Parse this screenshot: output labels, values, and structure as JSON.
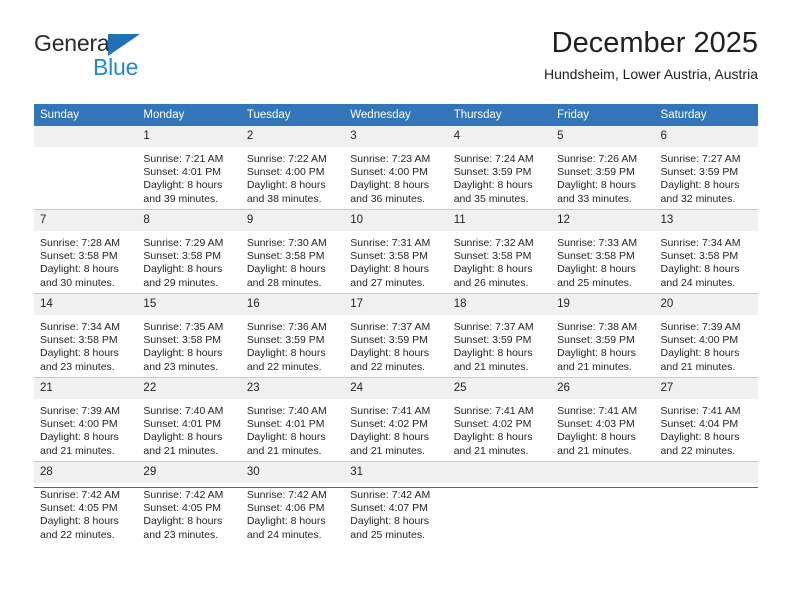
{
  "brand": {
    "name_part1": "General",
    "name_part2": "Blue",
    "logo_icon": "triangle-logo-icon",
    "accent_color": "#1f72b8",
    "text_color": "#2288dd"
  },
  "header": {
    "title": "December 2025",
    "location": "Hundsheim, Lower Austria, Austria"
  },
  "calendar": {
    "header_bg_color": "#3275b8",
    "daynum_bg_color": "#f0f0f0",
    "weekdays": [
      "Sunday",
      "Monday",
      "Tuesday",
      "Wednesday",
      "Thursday",
      "Friday",
      "Saturday"
    ],
    "weeks": [
      [
        {
          "day": "",
          "sunrise": "",
          "sunset": "",
          "daylight_line1": "",
          "daylight_line2": ""
        },
        {
          "day": "1",
          "sunrise": "Sunrise: 7:21 AM",
          "sunset": "Sunset: 4:01 PM",
          "daylight_line1": "Daylight: 8 hours",
          "daylight_line2": "and 39 minutes."
        },
        {
          "day": "2",
          "sunrise": "Sunrise: 7:22 AM",
          "sunset": "Sunset: 4:00 PM",
          "daylight_line1": "Daylight: 8 hours",
          "daylight_line2": "and 38 minutes."
        },
        {
          "day": "3",
          "sunrise": "Sunrise: 7:23 AM",
          "sunset": "Sunset: 4:00 PM",
          "daylight_line1": "Daylight: 8 hours",
          "daylight_line2": "and 36 minutes."
        },
        {
          "day": "4",
          "sunrise": "Sunrise: 7:24 AM",
          "sunset": "Sunset: 3:59 PM",
          "daylight_line1": "Daylight: 8 hours",
          "daylight_line2": "and 35 minutes."
        },
        {
          "day": "5",
          "sunrise": "Sunrise: 7:26 AM",
          "sunset": "Sunset: 3:59 PM",
          "daylight_line1": "Daylight: 8 hours",
          "daylight_line2": "and 33 minutes."
        },
        {
          "day": "6",
          "sunrise": "Sunrise: 7:27 AM",
          "sunset": "Sunset: 3:59 PM",
          "daylight_line1": "Daylight: 8 hours",
          "daylight_line2": "and 32 minutes."
        }
      ],
      [
        {
          "day": "7",
          "sunrise": "Sunrise: 7:28 AM",
          "sunset": "Sunset: 3:58 PM",
          "daylight_line1": "Daylight: 8 hours",
          "daylight_line2": "and 30 minutes."
        },
        {
          "day": "8",
          "sunrise": "Sunrise: 7:29 AM",
          "sunset": "Sunset: 3:58 PM",
          "daylight_line1": "Daylight: 8 hours",
          "daylight_line2": "and 29 minutes."
        },
        {
          "day": "9",
          "sunrise": "Sunrise: 7:30 AM",
          "sunset": "Sunset: 3:58 PM",
          "daylight_line1": "Daylight: 8 hours",
          "daylight_line2": "and 28 minutes."
        },
        {
          "day": "10",
          "sunrise": "Sunrise: 7:31 AM",
          "sunset": "Sunset: 3:58 PM",
          "daylight_line1": "Daylight: 8 hours",
          "daylight_line2": "and 27 minutes."
        },
        {
          "day": "11",
          "sunrise": "Sunrise: 7:32 AM",
          "sunset": "Sunset: 3:58 PM",
          "daylight_line1": "Daylight: 8 hours",
          "daylight_line2": "and 26 minutes."
        },
        {
          "day": "12",
          "sunrise": "Sunrise: 7:33 AM",
          "sunset": "Sunset: 3:58 PM",
          "daylight_line1": "Daylight: 8 hours",
          "daylight_line2": "and 25 minutes."
        },
        {
          "day": "13",
          "sunrise": "Sunrise: 7:34 AM",
          "sunset": "Sunset: 3:58 PM",
          "daylight_line1": "Daylight: 8 hours",
          "daylight_line2": "and 24 minutes."
        }
      ],
      [
        {
          "day": "14",
          "sunrise": "Sunrise: 7:34 AM",
          "sunset": "Sunset: 3:58 PM",
          "daylight_line1": "Daylight: 8 hours",
          "daylight_line2": "and 23 minutes."
        },
        {
          "day": "15",
          "sunrise": "Sunrise: 7:35 AM",
          "sunset": "Sunset: 3:58 PM",
          "daylight_line1": "Daylight: 8 hours",
          "daylight_line2": "and 23 minutes."
        },
        {
          "day": "16",
          "sunrise": "Sunrise: 7:36 AM",
          "sunset": "Sunset: 3:59 PM",
          "daylight_line1": "Daylight: 8 hours",
          "daylight_line2": "and 22 minutes."
        },
        {
          "day": "17",
          "sunrise": "Sunrise: 7:37 AM",
          "sunset": "Sunset: 3:59 PM",
          "daylight_line1": "Daylight: 8 hours",
          "daylight_line2": "and 22 minutes."
        },
        {
          "day": "18",
          "sunrise": "Sunrise: 7:37 AM",
          "sunset": "Sunset: 3:59 PM",
          "daylight_line1": "Daylight: 8 hours",
          "daylight_line2": "and 21 minutes."
        },
        {
          "day": "19",
          "sunrise": "Sunrise: 7:38 AM",
          "sunset": "Sunset: 3:59 PM",
          "daylight_line1": "Daylight: 8 hours",
          "daylight_line2": "and 21 minutes."
        },
        {
          "day": "20",
          "sunrise": "Sunrise: 7:39 AM",
          "sunset": "Sunset: 4:00 PM",
          "daylight_line1": "Daylight: 8 hours",
          "daylight_line2": "and 21 minutes."
        }
      ],
      [
        {
          "day": "21",
          "sunrise": "Sunrise: 7:39 AM",
          "sunset": "Sunset: 4:00 PM",
          "daylight_line1": "Daylight: 8 hours",
          "daylight_line2": "and 21 minutes."
        },
        {
          "day": "22",
          "sunrise": "Sunrise: 7:40 AM",
          "sunset": "Sunset: 4:01 PM",
          "daylight_line1": "Daylight: 8 hours",
          "daylight_line2": "and 21 minutes."
        },
        {
          "day": "23",
          "sunrise": "Sunrise: 7:40 AM",
          "sunset": "Sunset: 4:01 PM",
          "daylight_line1": "Daylight: 8 hours",
          "daylight_line2": "and 21 minutes."
        },
        {
          "day": "24",
          "sunrise": "Sunrise: 7:41 AM",
          "sunset": "Sunset: 4:02 PM",
          "daylight_line1": "Daylight: 8 hours",
          "daylight_line2": "and 21 minutes."
        },
        {
          "day": "25",
          "sunrise": "Sunrise: 7:41 AM",
          "sunset": "Sunset: 4:02 PM",
          "daylight_line1": "Daylight: 8 hours",
          "daylight_line2": "and 21 minutes."
        },
        {
          "day": "26",
          "sunrise": "Sunrise: 7:41 AM",
          "sunset": "Sunset: 4:03 PM",
          "daylight_line1": "Daylight: 8 hours",
          "daylight_line2": "and 21 minutes."
        },
        {
          "day": "27",
          "sunrise": "Sunrise: 7:41 AM",
          "sunset": "Sunset: 4:04 PM",
          "daylight_line1": "Daylight: 8 hours",
          "daylight_line2": "and 22 minutes."
        }
      ],
      [
        {
          "day": "28",
          "sunrise": "Sunrise: 7:42 AM",
          "sunset": "Sunset: 4:05 PM",
          "daylight_line1": "Daylight: 8 hours",
          "daylight_line2": "and 22 minutes."
        },
        {
          "day": "29",
          "sunrise": "Sunrise: 7:42 AM",
          "sunset": "Sunset: 4:05 PM",
          "daylight_line1": "Daylight: 8 hours",
          "daylight_line2": "and 23 minutes."
        },
        {
          "day": "30",
          "sunrise": "Sunrise: 7:42 AM",
          "sunset": "Sunset: 4:06 PM",
          "daylight_line1": "Daylight: 8 hours",
          "daylight_line2": "and 24 minutes."
        },
        {
          "day": "31",
          "sunrise": "Sunrise: 7:42 AM",
          "sunset": "Sunset: 4:07 PM",
          "daylight_line1": "Daylight: 8 hours",
          "daylight_line2": "and 25 minutes."
        },
        {
          "day": "",
          "sunrise": "",
          "sunset": "",
          "daylight_line1": "",
          "daylight_line2": ""
        },
        {
          "day": "",
          "sunrise": "",
          "sunset": "",
          "daylight_line1": "",
          "daylight_line2": ""
        },
        {
          "day": "",
          "sunrise": "",
          "sunset": "",
          "daylight_line1": "",
          "daylight_line2": ""
        }
      ]
    ]
  }
}
